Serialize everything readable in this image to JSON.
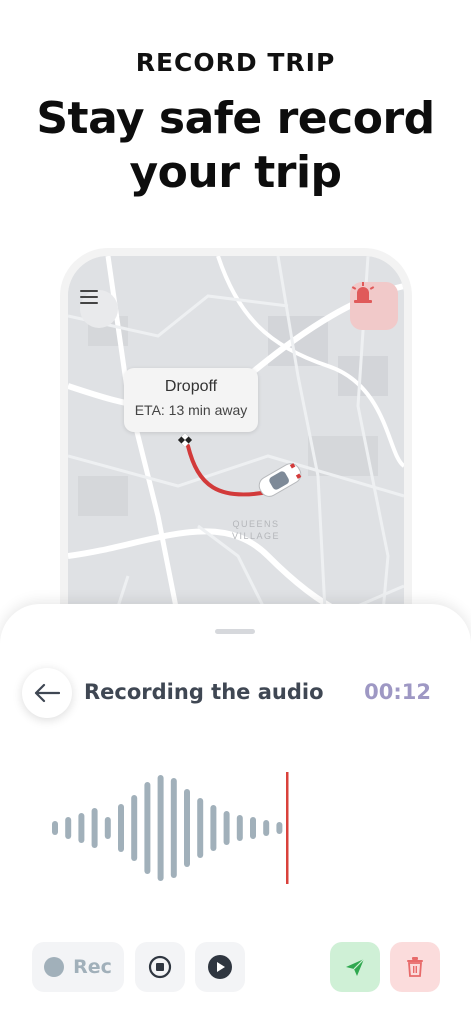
{
  "header": {
    "eyebrow": "RECORD TRIP",
    "headline_line1": "Stay safe record",
    "headline_line2": "your trip"
  },
  "map": {
    "dropoff_title": "Dropoff",
    "dropoff_eta": "ETA: 13 min away",
    "area_label_line1": "QUEENS",
    "area_label_line2": "VILLAGE",
    "route_color": "#d23a3a"
  },
  "recorder": {
    "title": "Recording the audio",
    "timer": "00:12",
    "rec_label": "Rec",
    "cursor_color": "#d9413b",
    "wave_color": "#a1b0ba"
  },
  "icons": {
    "menu": "hamburger-menu-icon",
    "alarm": "siren-icon",
    "back": "arrow-left-icon",
    "stop": "stop-icon",
    "play": "play-icon",
    "send": "send-icon",
    "delete": "trash-icon"
  }
}
